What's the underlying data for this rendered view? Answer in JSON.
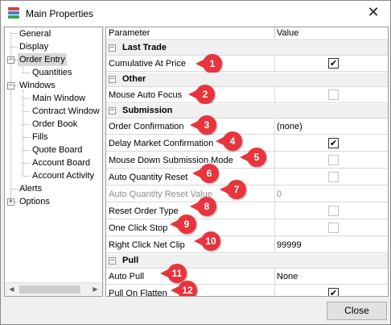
{
  "window": {
    "title": "Main Properties"
  },
  "tree": {
    "items": [
      {
        "label": "General"
      },
      {
        "label": "Display"
      },
      {
        "label": "Order Entry"
      },
      {
        "label": "Quantities"
      },
      {
        "label": "Windows"
      },
      {
        "label": "Main Window"
      },
      {
        "label": "Contract Window"
      },
      {
        "label": "Order Book"
      },
      {
        "label": "Fills"
      },
      {
        "label": "Quote Board"
      },
      {
        "label": "Account Board"
      },
      {
        "label": "Account Activity"
      },
      {
        "label": "Alerts"
      },
      {
        "label": "Options"
      }
    ]
  },
  "grid": {
    "header": {
      "parameter": "Parameter",
      "value": "Value"
    },
    "categories": [
      {
        "label": "Last Trade"
      },
      {
        "label": "Other"
      },
      {
        "label": "Submission"
      },
      {
        "label": "Pull"
      }
    ],
    "rows": [
      {
        "name": "Cumulative At Price",
        "value": "",
        "checked": true,
        "badge": "1"
      },
      {
        "name": "Mouse Auto Focus",
        "value": "",
        "checked": false,
        "badge": "2"
      },
      {
        "name": "Order Confirmation",
        "value": "(none)",
        "badge": "3"
      },
      {
        "name": "Delay Market Confirmation",
        "value": "",
        "checked": true,
        "badge": "4"
      },
      {
        "name": "Mouse Down Submission Mode",
        "value": "",
        "checked": false,
        "badge": "5"
      },
      {
        "name": "Auto Quantity Reset",
        "value": "",
        "checked": false,
        "badge": "6"
      },
      {
        "name": "Auto Quantity Reset Value",
        "value": "0",
        "badge": "7"
      },
      {
        "name": "Reset Order Type",
        "value": "",
        "checked": false,
        "badge": "8"
      },
      {
        "name": "One Click Stop",
        "value": "",
        "checked": false,
        "badge": "9"
      },
      {
        "name": "Right Click Net Clip",
        "value": "99999",
        "badge": "10"
      },
      {
        "name": "Auto Pull",
        "value": "None",
        "badge": "11"
      },
      {
        "name": "Pull On Flatten",
        "value": "",
        "checked": true,
        "badge": "12"
      }
    ]
  },
  "glyphs": {
    "checkmark": "✔",
    "expand": "+",
    "collapse": "−",
    "close": "✕",
    "arrow_left": "◀",
    "arrow_right": "▶"
  },
  "buttons": {
    "close_label": "Close"
  },
  "colors": {
    "badge": "#e8343d",
    "selected_tree": "#d9d9d9"
  }
}
